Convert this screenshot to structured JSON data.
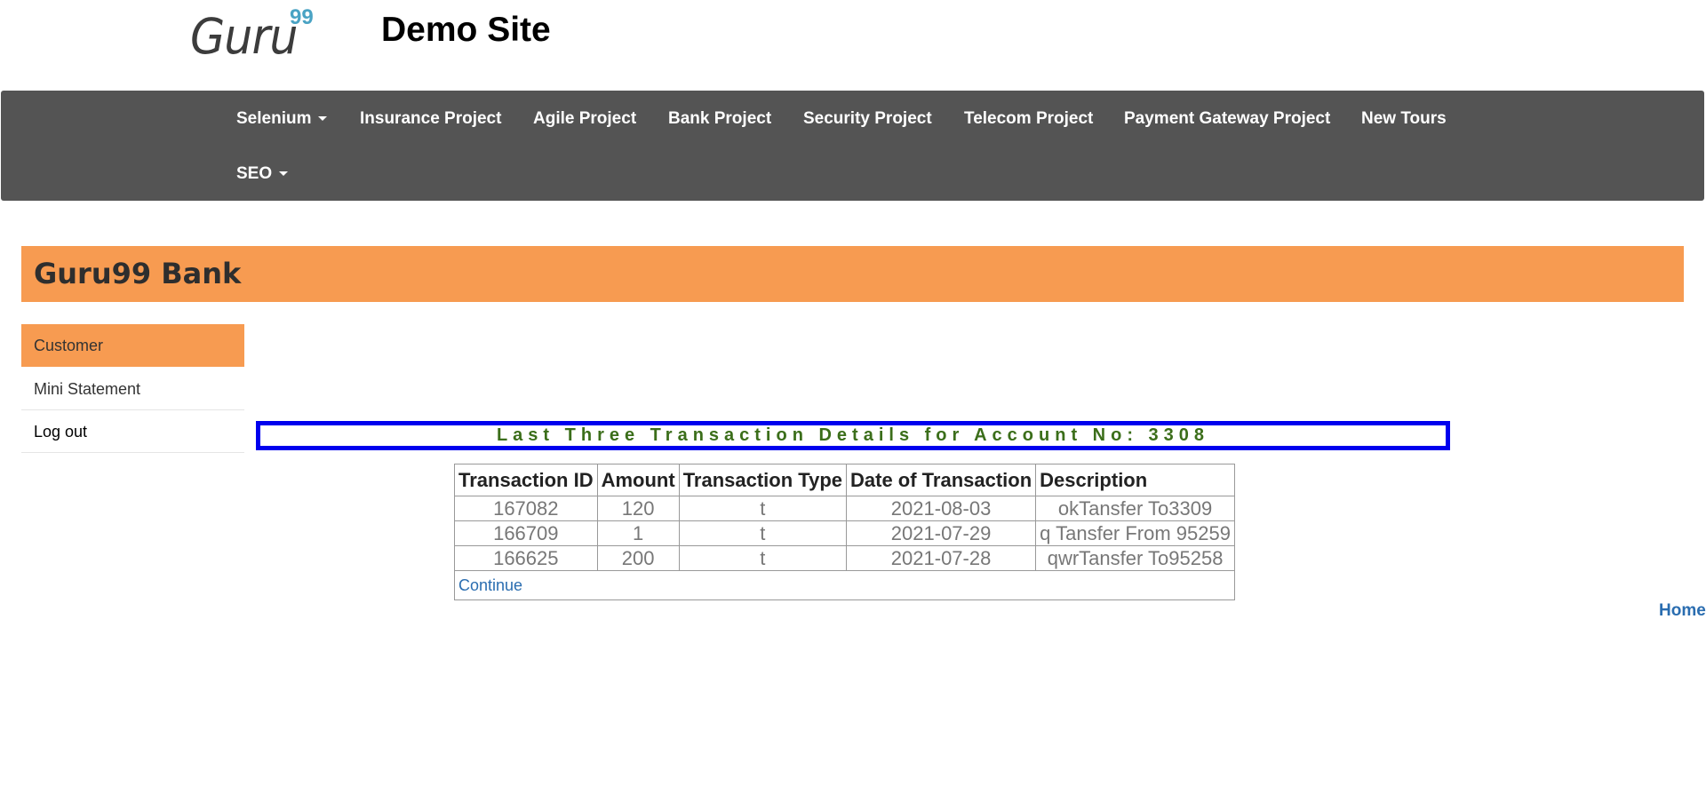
{
  "header": {
    "logo_text": "Guru",
    "logo_sup": "99",
    "site_title": "Demo Site"
  },
  "nav": {
    "items": [
      {
        "label": "Selenium"
      },
      {
        "label": "Insurance Project"
      },
      {
        "label": "Agile Project"
      },
      {
        "label": "Bank Project"
      },
      {
        "label": "Security Project"
      },
      {
        "label": "Telecom Project"
      },
      {
        "label": "Payment Gateway Project"
      },
      {
        "label": "New Tours"
      },
      {
        "label": "SEO"
      }
    ]
  },
  "bank": {
    "title": "Guru99 Bank"
  },
  "sidebar": {
    "items": [
      {
        "label": "Customer"
      },
      {
        "label": "Mini Statement"
      },
      {
        "label": "Log out"
      }
    ]
  },
  "statement": {
    "heading": "Last Three Transaction Details for Account No: 3308",
    "headers": [
      "Transaction ID",
      "Amount",
      "Transaction Type",
      "Date of Transaction",
      "Description"
    ],
    "rows": [
      [
        "167082",
        "120",
        "t",
        "2021-08-03",
        "okTansfer To3309"
      ],
      [
        "166709",
        "1",
        "t",
        "2021-07-29",
        "q Tansfer From 95259"
      ],
      [
        "166625",
        "200",
        "t",
        "2021-07-28",
        "qwrTansfer To95258"
      ]
    ],
    "continue_label": "Continue"
  },
  "footer": {
    "home_label": "Home"
  },
  "colors": {
    "navbar": "#545454",
    "accent_orange": "#f79b51",
    "heading_border": "#0000ee",
    "heading_text": "#3b6e1a",
    "link": "#2a6db0"
  }
}
